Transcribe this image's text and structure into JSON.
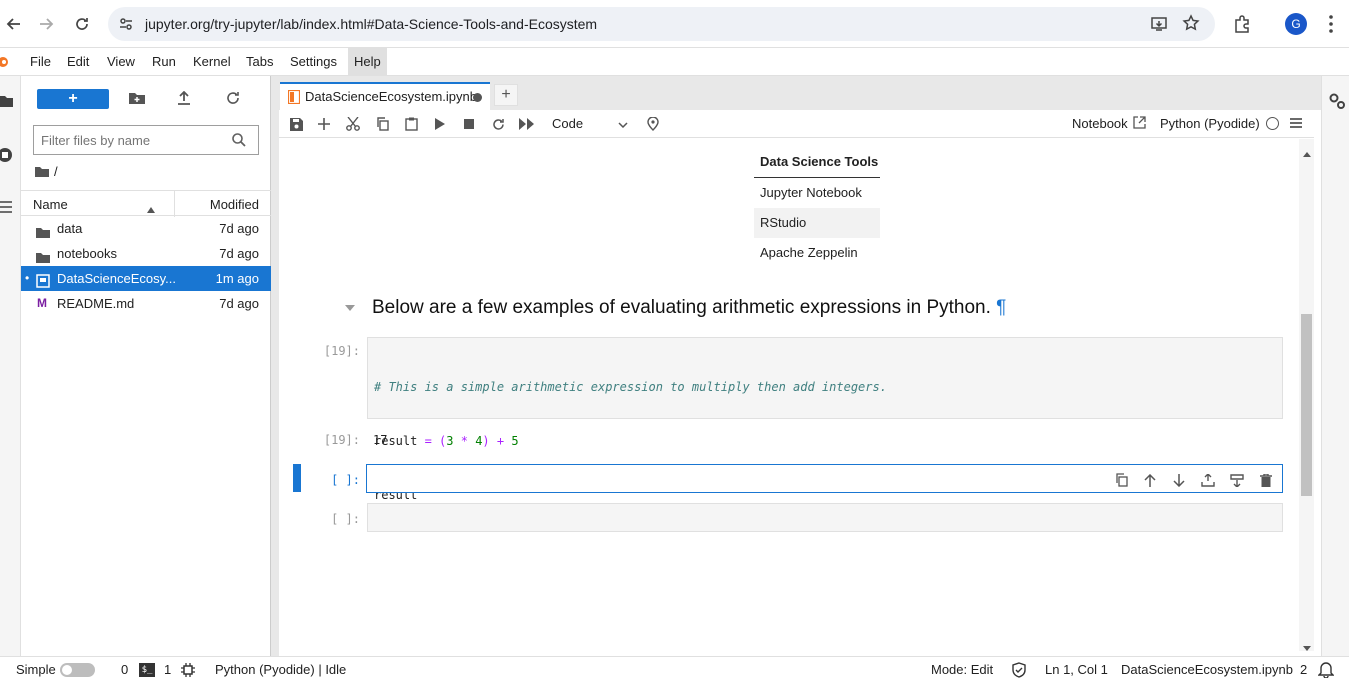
{
  "browser": {
    "url": "jupyter.org/try-jupyter/lab/index.html#Data-Science-Tools-and-Ecosystem",
    "profile_initial": "G"
  },
  "menubar": {
    "items": [
      "File",
      "Edit",
      "View",
      "Run",
      "Kernel",
      "Tabs",
      "Settings",
      "Help"
    ]
  },
  "filebrowser": {
    "new_label": "+",
    "filter_placeholder": "Filter files by name",
    "breadcrumb": "/",
    "col_name": "Name",
    "col_modified": "Modified",
    "files": [
      {
        "name": "data",
        "modified": "7d ago",
        "type": "folder"
      },
      {
        "name": "notebooks",
        "modified": "7d ago",
        "type": "folder"
      },
      {
        "name": "DataScienceEcosy...",
        "modified": "1m ago",
        "type": "notebook",
        "selected": true
      },
      {
        "name": "README.md",
        "modified": "7d ago",
        "type": "markdown"
      }
    ]
  },
  "notebook": {
    "tab_title": "DataScienceEcosystem.ipynb",
    "cell_type": "Code",
    "notebook_label": "Notebook",
    "kernel_name": "Python (Pyodide)",
    "table": {
      "header": "Data Science Tools",
      "rows": [
        "Jupyter Notebook",
        "RStudio",
        "Apache Zeppelin"
      ]
    },
    "heading": "Below are a few examples of evaluating arithmetic expressions in Python.",
    "heading_anchor": "¶",
    "cells": [
      {
        "prompt": "[19]:",
        "line1": "# This is a simple arithmetic expression to multiply then add integers.",
        "line2_a": "result",
        "line2_b": " = (",
        "line2_c": "3",
        "line2_d": " * ",
        "line2_e": "4",
        "line2_f": ") + ",
        "line2_g": "5",
        "line3": "result"
      },
      {
        "output_prompt": "[19]:",
        "output": "17"
      },
      {
        "prompt": "[ ]:"
      },
      {
        "prompt": "[ ]:"
      }
    ]
  },
  "statusbar": {
    "mode_simple": "Simple",
    "terminals": "0",
    "kernels": "1",
    "kernel_status": "Python (Pyodide) | Idle",
    "mode": "Mode: Edit",
    "cursor": "Ln 1, Col 1",
    "filename": "DataScienceEcosystem.ipynb",
    "notifications": "2"
  },
  "colors": {
    "accent": "#1976d2",
    "selected_row": "#1976d2",
    "comment": "#408080",
    "number": "#008000",
    "operator": "#aa22ff"
  }
}
